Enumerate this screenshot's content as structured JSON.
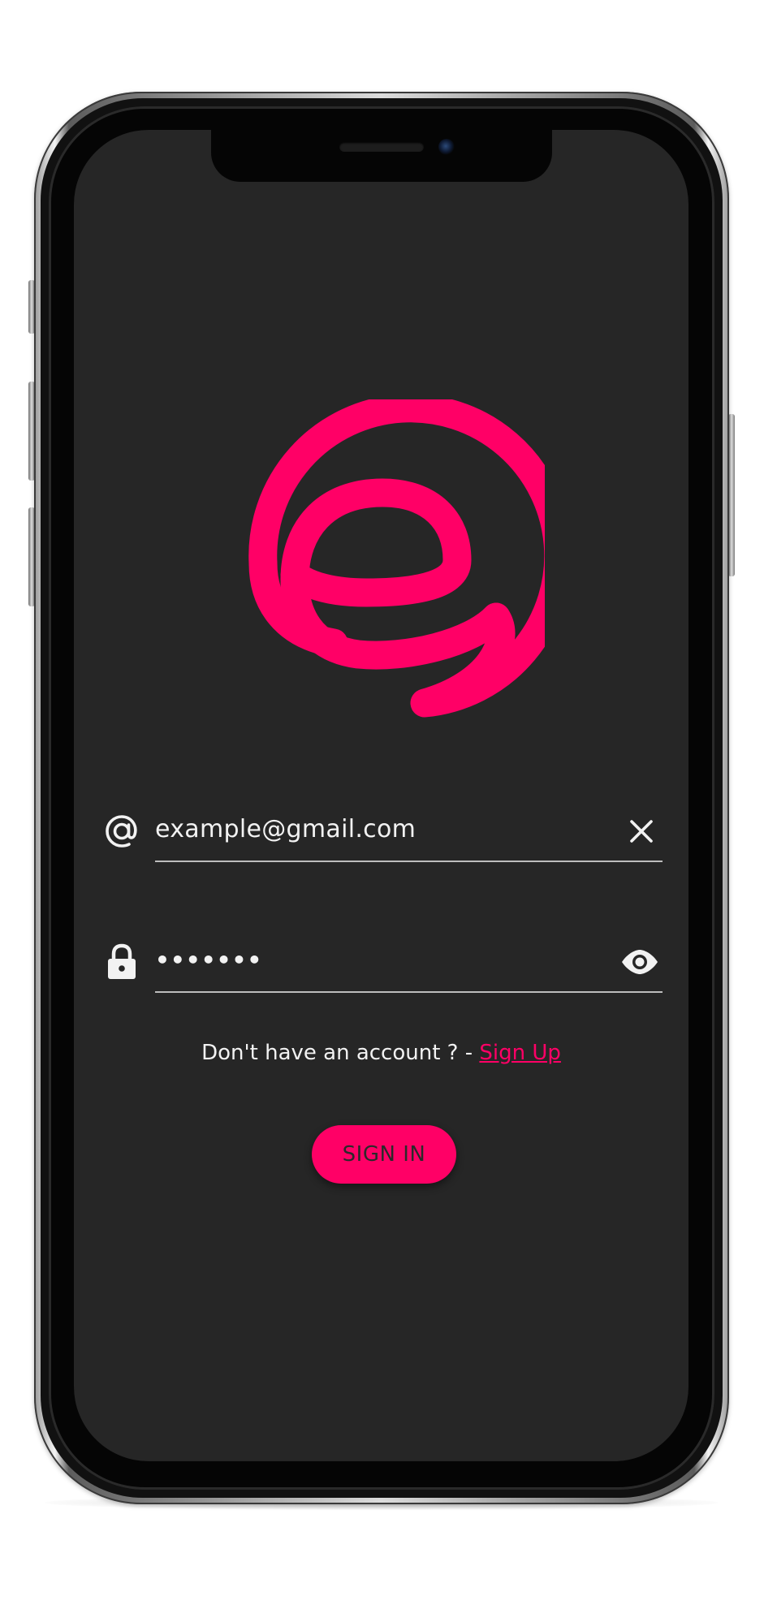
{
  "colors": {
    "accent": "#ff0066",
    "background": "#262626",
    "text": "#f2f2f2",
    "underline": "#bdbdbd"
  },
  "logo": {
    "icon": "e-swirl-logo"
  },
  "email_field": {
    "icon": "at-sign-icon",
    "value": "example@gmail.com",
    "action_icon": "close-icon"
  },
  "password_field": {
    "icon": "lock-icon",
    "value": "•••••••",
    "action_icon": "eye-icon"
  },
  "signup": {
    "prompt": "Don't have an account ? - ",
    "link_label": "Sign Up"
  },
  "signin_button": {
    "label": "SIGN IN"
  }
}
